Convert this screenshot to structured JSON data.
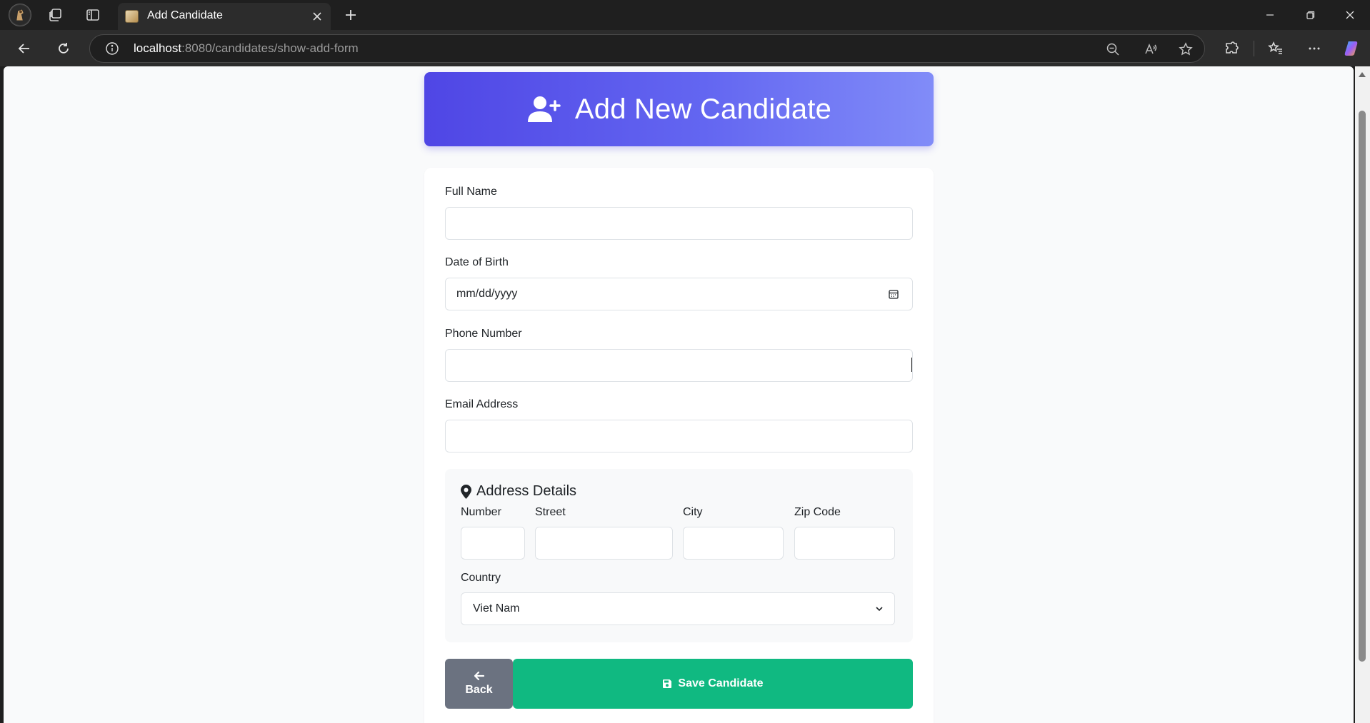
{
  "browser": {
    "tab_title": "Add Candidate",
    "url_host": "localhost",
    "url_rest": ":8080/candidates/show-add-form"
  },
  "page": {
    "header_title": "Add New Candidate",
    "icons": {
      "header": "user-plus-icon",
      "address": "map-marker-icon",
      "back": "arrow-left-icon",
      "save": "floppy-disk-icon",
      "date": "calendar-icon",
      "select": "chevron-down-icon"
    },
    "colors": {
      "header_start": "#4f46e5",
      "header_end": "#818cf8",
      "save_button": "#10b981",
      "back_button": "#6b7280"
    }
  },
  "form": {
    "full_name": {
      "label": "Full Name",
      "value": ""
    },
    "date_of_birth": {
      "label": "Date of Birth",
      "value": "mm/dd/yyyy"
    },
    "phone_number": {
      "label": "Phone Number",
      "value": ""
    },
    "email_address": {
      "label": "Email Address",
      "value": ""
    },
    "address": {
      "title": "Address Details",
      "number_label": "Number",
      "street_label": "Street",
      "city_label": "City",
      "zip_label": "Zip Code",
      "country_label": "Country",
      "country_value": "Viet Nam"
    },
    "buttons": {
      "back": "Back",
      "save": "Save Candidate"
    }
  }
}
